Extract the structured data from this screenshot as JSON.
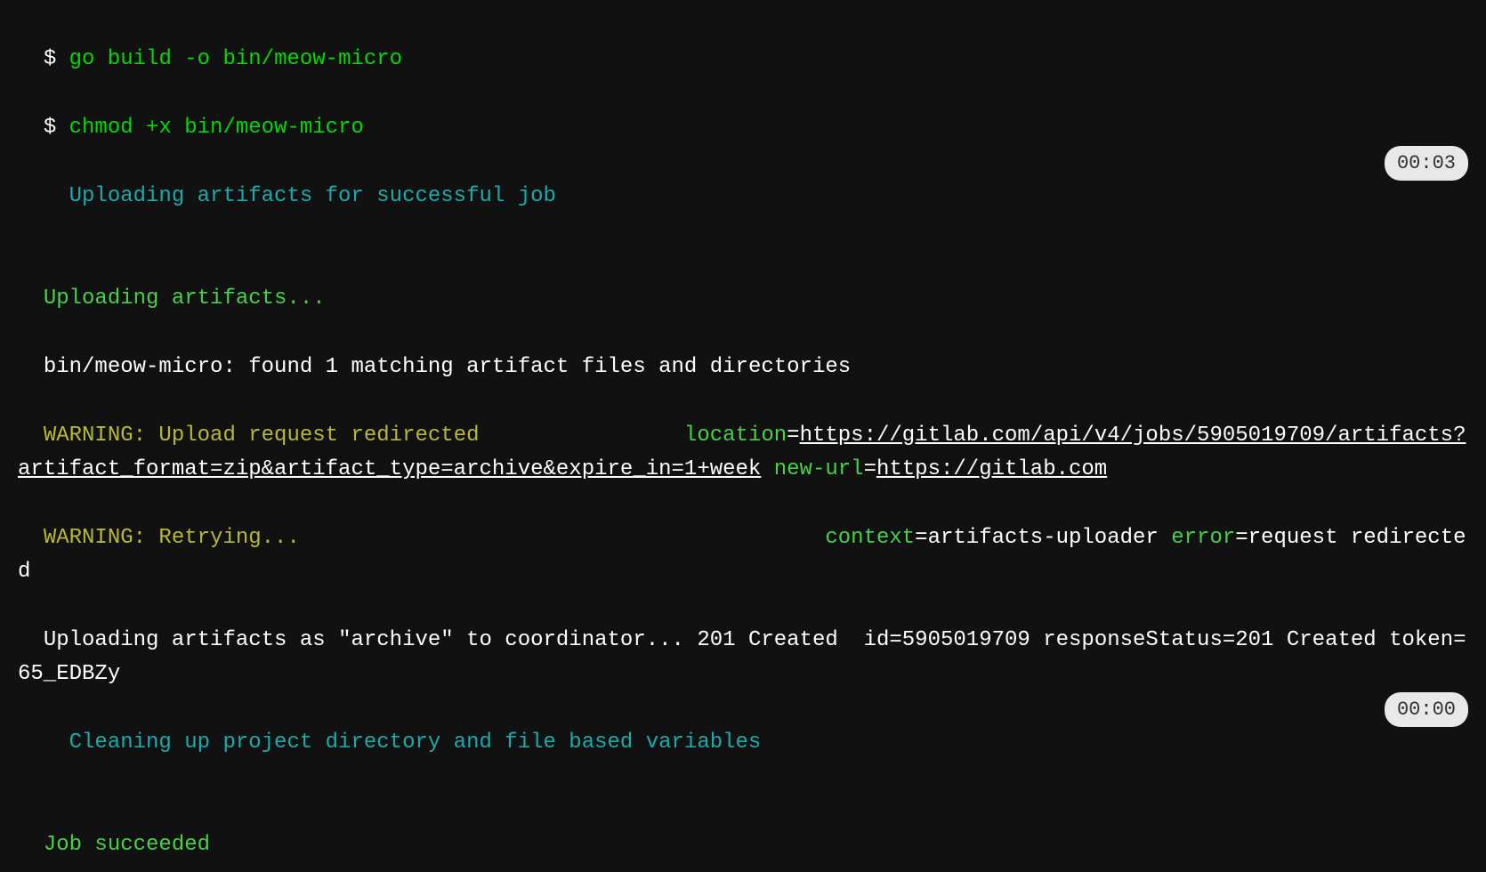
{
  "lines": {
    "l1": {
      "prompt": "$ ",
      "cmd": "go build -o bin/meow-micro"
    },
    "l2": {
      "prompt": "$ ",
      "cmd": "chmod +x bin/meow-micro"
    },
    "l3": {
      "section": "Uploading artifacts for successful job",
      "time": "00:03"
    },
    "l4": {
      "status": "Uploading artifacts..."
    },
    "l5": {
      "plain": "bin/meow-micro: found 1 matching artifact files and directories "
    },
    "l6": {
      "warn": "WARNING: Upload request redirected               ",
      "key1": " location",
      "eq1": "=",
      "link1": "https://gitlab.com/api/v4/jobs/5905019709/artifacts?artifact_format=zip&artifact_type=archive&expire_in=1+week",
      "key2": " new-url",
      "eq2": "=",
      "link2": "https://gitlab.com"
    },
    "l7": {
      "warn": "WARNING: Retrying...                                        ",
      "key1": " context",
      "eq1": "=",
      "val1": "artifacts-uploader",
      "key2": " error",
      "eq2": "=",
      "val2": "request redirected"
    },
    "l8": {
      "plain": "Uploading artifacts as \"archive\" to coordinator... 201 Created  id",
      "eq1": "=",
      "val1": "5905019709 responseStatus",
      "eq2": "=",
      "val2": "201 Created token",
      "eq3": "=",
      "val3": "65_EDBZy"
    },
    "l9": {
      "section": "Cleaning up project directory and file based variables",
      "time": "00:00"
    },
    "l10": {
      "status": "Job succeeded"
    }
  }
}
